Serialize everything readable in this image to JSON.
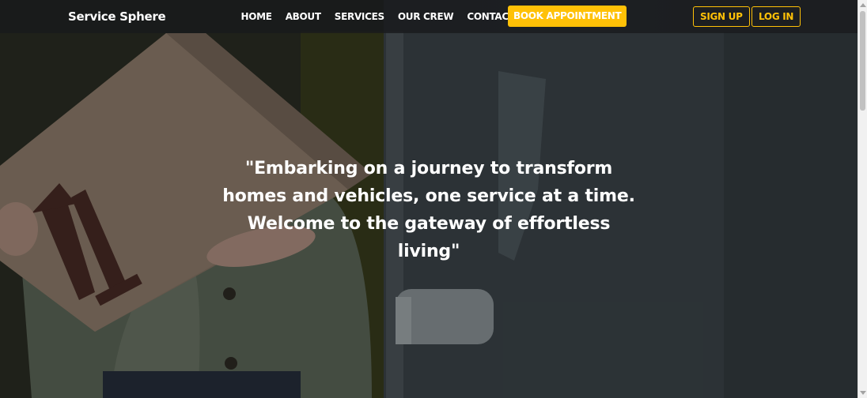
{
  "navbar": {
    "brand": "Service Sphere",
    "links": [
      "HOME",
      "ABOUT",
      "SERVICES",
      "OUR CREW",
      "CONTACT"
    ],
    "book_label": "BOOK APPOINTMENT",
    "signup_label": "SIGN UP",
    "login_label": "LOG IN"
  },
  "hero": {
    "quote": "\"Embarking on a journey to transform homes and vehicles, one service at a time. Welcome to the gateway of effortless living\""
  },
  "colors": {
    "accent": "#ffc107",
    "navbar_bg": "#1f2224",
    "text": "#ffffff"
  }
}
